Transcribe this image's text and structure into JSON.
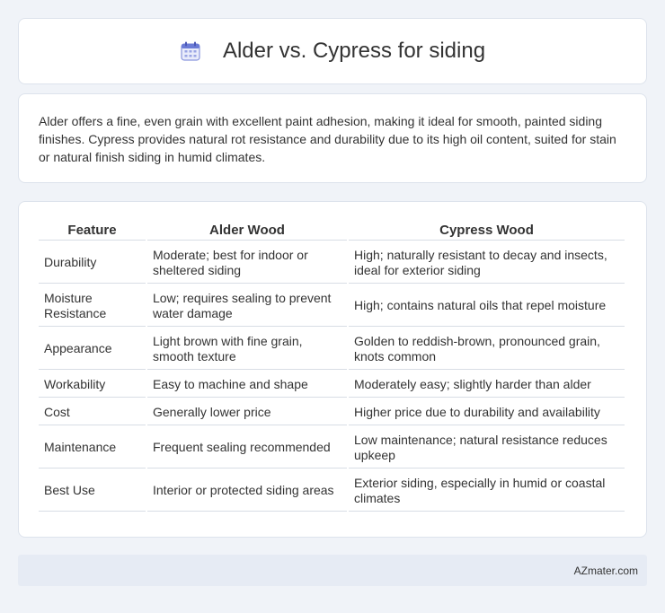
{
  "page": {
    "title": "Alder vs. Cypress for siding",
    "title_icon": "calendar-icon",
    "accent_color": "#6b7bd6"
  },
  "summary": "Alder offers a fine, even grain with excellent paint adhesion, making it ideal for smooth, painted siding finishes. Cypress provides natural rot resistance and durability due to its high oil content, suited for stain or natural finish siding in humid climates.",
  "table": {
    "headers": [
      "Feature",
      "Alder Wood",
      "Cypress Wood"
    ],
    "rows": [
      {
        "feature": "Durability",
        "alder": "Moderate; best for indoor or sheltered siding",
        "cypress": "High; naturally resistant to decay and insects, ideal for exterior siding"
      },
      {
        "feature": "Moisture Resistance",
        "alder": "Low; requires sealing to prevent water damage",
        "cypress": "High; contains natural oils that repel moisture"
      },
      {
        "feature": "Appearance",
        "alder": "Light brown with fine grain, smooth texture",
        "cypress": "Golden to reddish-brown, pronounced grain, knots common"
      },
      {
        "feature": "Workability",
        "alder": "Easy to machine and shape",
        "cypress": "Moderately easy; slightly harder than alder"
      },
      {
        "feature": "Cost",
        "alder": "Generally lower price",
        "cypress": "Higher price due to durability and availability"
      },
      {
        "feature": "Maintenance",
        "alder": "Frequent sealing recommended",
        "cypress": "Low maintenance; natural resistance reduces upkeep"
      },
      {
        "feature": "Best Use",
        "alder": "Interior or protected siding areas",
        "cypress": "Exterior siding, especially in humid or coastal climates"
      }
    ]
  },
  "footer": {
    "brand": "AZmater.com"
  }
}
